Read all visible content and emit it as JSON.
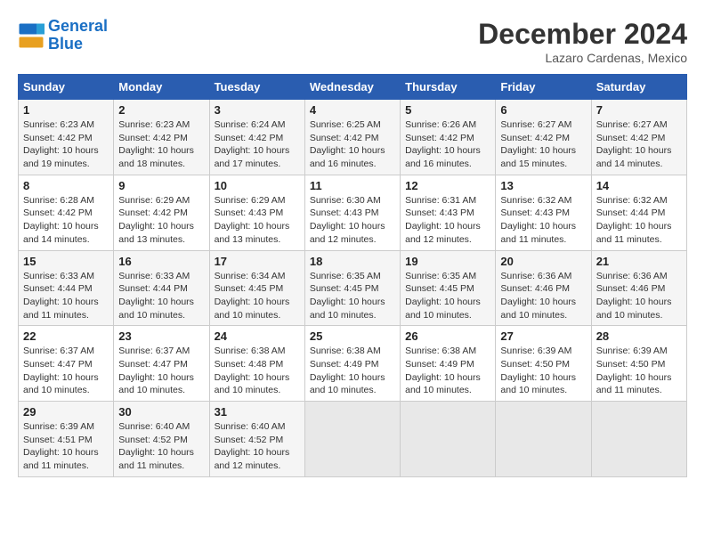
{
  "header": {
    "logo_line1": "General",
    "logo_line2": "Blue",
    "month": "December 2024",
    "location": "Lazaro Cardenas, Mexico"
  },
  "days_of_week": [
    "Sunday",
    "Monday",
    "Tuesday",
    "Wednesday",
    "Thursday",
    "Friday",
    "Saturday"
  ],
  "weeks": [
    [
      {
        "day": "1",
        "info": "Sunrise: 6:23 AM\nSunset: 4:42 PM\nDaylight: 10 hours\nand 19 minutes."
      },
      {
        "day": "2",
        "info": "Sunrise: 6:23 AM\nSunset: 4:42 PM\nDaylight: 10 hours\nand 18 minutes."
      },
      {
        "day": "3",
        "info": "Sunrise: 6:24 AM\nSunset: 4:42 PM\nDaylight: 10 hours\nand 17 minutes."
      },
      {
        "day": "4",
        "info": "Sunrise: 6:25 AM\nSunset: 4:42 PM\nDaylight: 10 hours\nand 16 minutes."
      },
      {
        "day": "5",
        "info": "Sunrise: 6:26 AM\nSunset: 4:42 PM\nDaylight: 10 hours\nand 16 minutes."
      },
      {
        "day": "6",
        "info": "Sunrise: 6:27 AM\nSunset: 4:42 PM\nDaylight: 10 hours\nand 15 minutes."
      },
      {
        "day": "7",
        "info": "Sunrise: 6:27 AM\nSunset: 4:42 PM\nDaylight: 10 hours\nand 14 minutes."
      }
    ],
    [
      {
        "day": "8",
        "info": "Sunrise: 6:28 AM\nSunset: 4:42 PM\nDaylight: 10 hours\nand 14 minutes."
      },
      {
        "day": "9",
        "info": "Sunrise: 6:29 AM\nSunset: 4:42 PM\nDaylight: 10 hours\nand 13 minutes."
      },
      {
        "day": "10",
        "info": "Sunrise: 6:29 AM\nSunset: 4:43 PM\nDaylight: 10 hours\nand 13 minutes."
      },
      {
        "day": "11",
        "info": "Sunrise: 6:30 AM\nSunset: 4:43 PM\nDaylight: 10 hours\nand 12 minutes."
      },
      {
        "day": "12",
        "info": "Sunrise: 6:31 AM\nSunset: 4:43 PM\nDaylight: 10 hours\nand 12 minutes."
      },
      {
        "day": "13",
        "info": "Sunrise: 6:32 AM\nSunset: 4:43 PM\nDaylight: 10 hours\nand 11 minutes."
      },
      {
        "day": "14",
        "info": "Sunrise: 6:32 AM\nSunset: 4:44 PM\nDaylight: 10 hours\nand 11 minutes."
      }
    ],
    [
      {
        "day": "15",
        "info": "Sunrise: 6:33 AM\nSunset: 4:44 PM\nDaylight: 10 hours\nand 11 minutes."
      },
      {
        "day": "16",
        "info": "Sunrise: 6:33 AM\nSunset: 4:44 PM\nDaylight: 10 hours\nand 10 minutes."
      },
      {
        "day": "17",
        "info": "Sunrise: 6:34 AM\nSunset: 4:45 PM\nDaylight: 10 hours\nand 10 minutes."
      },
      {
        "day": "18",
        "info": "Sunrise: 6:35 AM\nSunset: 4:45 PM\nDaylight: 10 hours\nand 10 minutes."
      },
      {
        "day": "19",
        "info": "Sunrise: 6:35 AM\nSunset: 4:45 PM\nDaylight: 10 hours\nand 10 minutes."
      },
      {
        "day": "20",
        "info": "Sunrise: 6:36 AM\nSunset: 4:46 PM\nDaylight: 10 hours\nand 10 minutes."
      },
      {
        "day": "21",
        "info": "Sunrise: 6:36 AM\nSunset: 4:46 PM\nDaylight: 10 hours\nand 10 minutes."
      }
    ],
    [
      {
        "day": "22",
        "info": "Sunrise: 6:37 AM\nSunset: 4:47 PM\nDaylight: 10 hours\nand 10 minutes."
      },
      {
        "day": "23",
        "info": "Sunrise: 6:37 AM\nSunset: 4:47 PM\nDaylight: 10 hours\nand 10 minutes."
      },
      {
        "day": "24",
        "info": "Sunrise: 6:38 AM\nSunset: 4:48 PM\nDaylight: 10 hours\nand 10 minutes."
      },
      {
        "day": "25",
        "info": "Sunrise: 6:38 AM\nSunset: 4:49 PM\nDaylight: 10 hours\nand 10 minutes."
      },
      {
        "day": "26",
        "info": "Sunrise: 6:38 AM\nSunset: 4:49 PM\nDaylight: 10 hours\nand 10 minutes."
      },
      {
        "day": "27",
        "info": "Sunrise: 6:39 AM\nSunset: 4:50 PM\nDaylight: 10 hours\nand 10 minutes."
      },
      {
        "day": "28",
        "info": "Sunrise: 6:39 AM\nSunset: 4:50 PM\nDaylight: 10 hours\nand 11 minutes."
      }
    ],
    [
      {
        "day": "29",
        "info": "Sunrise: 6:39 AM\nSunset: 4:51 PM\nDaylight: 10 hours\nand 11 minutes."
      },
      {
        "day": "30",
        "info": "Sunrise: 6:40 AM\nSunset: 4:52 PM\nDaylight: 10 hours\nand 11 minutes."
      },
      {
        "day": "31",
        "info": "Sunrise: 6:40 AM\nSunset: 4:52 PM\nDaylight: 10 hours\nand 12 minutes."
      },
      null,
      null,
      null,
      null
    ]
  ]
}
